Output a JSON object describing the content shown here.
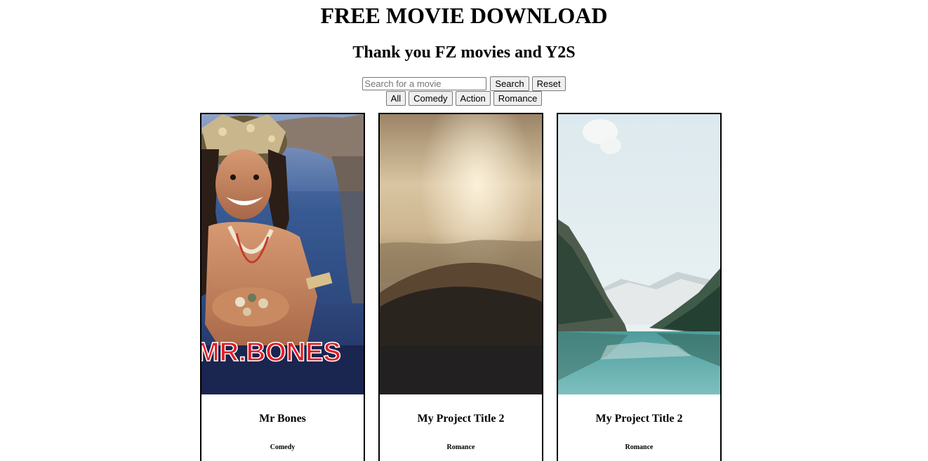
{
  "header": {
    "title": "FREE MOVIE DOWNLOAD",
    "subtitle": "Thank you FZ movies and Y2S"
  },
  "search": {
    "placeholder": "Search for a movie",
    "value": "",
    "search_label": "Search",
    "reset_label": "Reset"
  },
  "filters": [
    {
      "label": "All"
    },
    {
      "label": "Comedy"
    },
    {
      "label": "Action"
    },
    {
      "label": "Romance"
    }
  ],
  "movies": [
    {
      "title": "Mr Bones",
      "genre": "Comedy",
      "poster_text": "MR.BONES"
    },
    {
      "title": "My Project Title 2",
      "genre": "Romance"
    },
    {
      "title": "My Project Title 2",
      "genre": "Romance"
    }
  ],
  "colors": {
    "border": "#000000",
    "button_bg": "#efefef",
    "poster_title_red": "#e01e25"
  }
}
